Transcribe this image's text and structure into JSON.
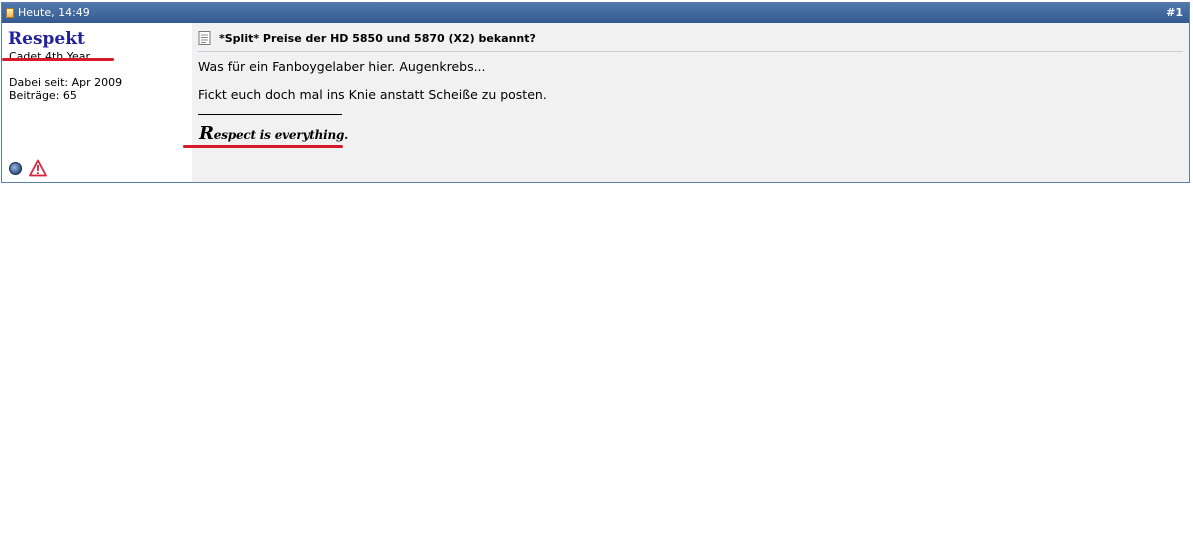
{
  "post": {
    "date": "Heute, 14:49",
    "number": "#1",
    "user": {
      "name": "Respekt",
      "title": "Cadet 4th Year",
      "joined": "Dabei seit: Apr 2009",
      "posts": "Beiträge: 65"
    },
    "title": "*Split* Preise der HD 5850 und 5870 (X2) bekannt?",
    "message": [
      "Was für ein Fanboygelaber hier. Augenkrebs...",
      "Fickt euch doch mal ins Knie anstatt Scheiße zu posten."
    ],
    "signature": {
      "initial": "R",
      "rest": "espect is everything."
    },
    "icons": [
      "post-icon",
      "online-status-icon",
      "report-icon",
      "document-icon"
    ],
    "colors": {
      "header": "#3d639b",
      "username": "#22229c",
      "annotation": "#d61a28"
    }
  }
}
